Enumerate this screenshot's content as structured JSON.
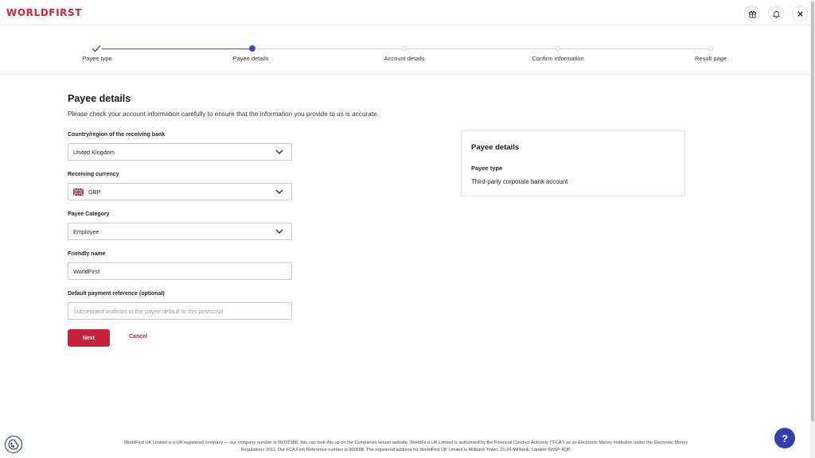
{
  "brand": {
    "logo_text": "WORLDFIRST",
    "accent": "#d0253b",
    "primary_button": "#c8223a",
    "step_active": "#3a4cc4"
  },
  "topbar": {
    "icons": [
      "gift-icon",
      "bell-icon",
      "close-icon"
    ]
  },
  "stepper": {
    "steps": [
      {
        "label": "Payee type",
        "state": "completed"
      },
      {
        "label": "Payee details",
        "state": "current"
      },
      {
        "label": "Account details",
        "state": "upcoming"
      },
      {
        "label": "Confirm information",
        "state": "upcoming"
      },
      {
        "label": "Result page",
        "state": "upcoming"
      }
    ]
  },
  "form": {
    "title": "Payee details",
    "subtitle": "Please check your account information carefully to ensure that the information you provide to us is accurate.",
    "country": {
      "label": "Country/region of the receiving bank",
      "value": "United Kingdom"
    },
    "currency": {
      "label": "Receiving currency",
      "value": "GBP",
      "flag_icon": "uk-flag-icon"
    },
    "category": {
      "label": "Payee Category",
      "value": "Employee"
    },
    "friendly_name": {
      "label": "Friendly name",
      "value": "WorldFirst"
    },
    "reference": {
      "label": "Default payment reference (optional)",
      "value": "",
      "placeholder": "Subsequent outflows to the payee default to this postscript"
    },
    "next_label": "Next",
    "cancel_label": "Cancel"
  },
  "summary": {
    "title": "Payee details",
    "key": "Payee type",
    "value": "Third-party corporate bank account"
  },
  "footer": {
    "line1": "WorldFirst UK Limited is a UK registered company — our company number is 05022388. You can look this up on the Companies House website. WorldFirst UK Limited is authorised by the Financial Conduct Authority (\"FCA\") as an Electronic Money Institution under the Electronic Money",
    "line2": "Regulations 2011. Our FCA Firm Reference number is 900508. The registered address for WorldFirst UK Limited is Millbank Tower, 21-24 Millbank, London SW1P 4QP."
  },
  "help": {
    "label": "?"
  }
}
